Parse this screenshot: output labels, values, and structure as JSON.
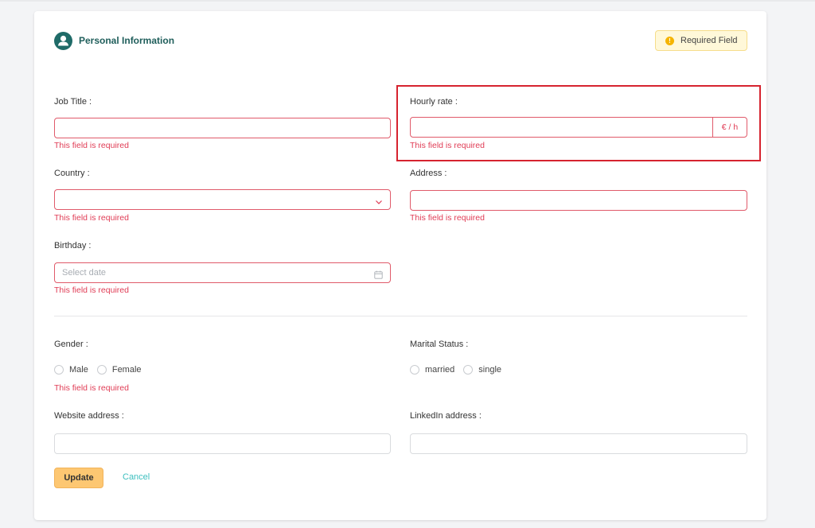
{
  "header": {
    "title": "Personal Information",
    "required_badge": "Required Field",
    "required_icon": "!"
  },
  "fields": {
    "job_title": {
      "label": "Job Title",
      "value": "",
      "error": "This field is required"
    },
    "hourly_rate": {
      "label": "Hourly rate",
      "value": "",
      "suffix": "€ / h",
      "error": "This field is required"
    },
    "country": {
      "label": "Country",
      "value": "",
      "error": "This field is required"
    },
    "address": {
      "label": "Address",
      "value": "",
      "error": "This field is required"
    },
    "birthday": {
      "label": "Birthday",
      "placeholder": "Select date",
      "error": "This field is required"
    },
    "gender": {
      "label": "Gender",
      "options": [
        "Male",
        "Female"
      ],
      "error": "This field is required"
    },
    "marital_status": {
      "label": "Marital Status",
      "options": [
        "married",
        "single"
      ]
    },
    "website": {
      "label": "Website address",
      "value": ""
    },
    "linkedin": {
      "label": "LinkedIn address",
      "value": ""
    }
  },
  "actions": {
    "update": "Update",
    "cancel": "Cancel"
  },
  "colors": {
    "brand": "#1f6b68",
    "error": "#e03c55",
    "primary_button": "#fdc772",
    "link": "#3cbfbf",
    "highlight": "#d6232f"
  },
  "icons": {
    "header": "user-circle-icon",
    "country_select": "chevron-down-icon",
    "birthday_picker": "calendar-icon"
  }
}
